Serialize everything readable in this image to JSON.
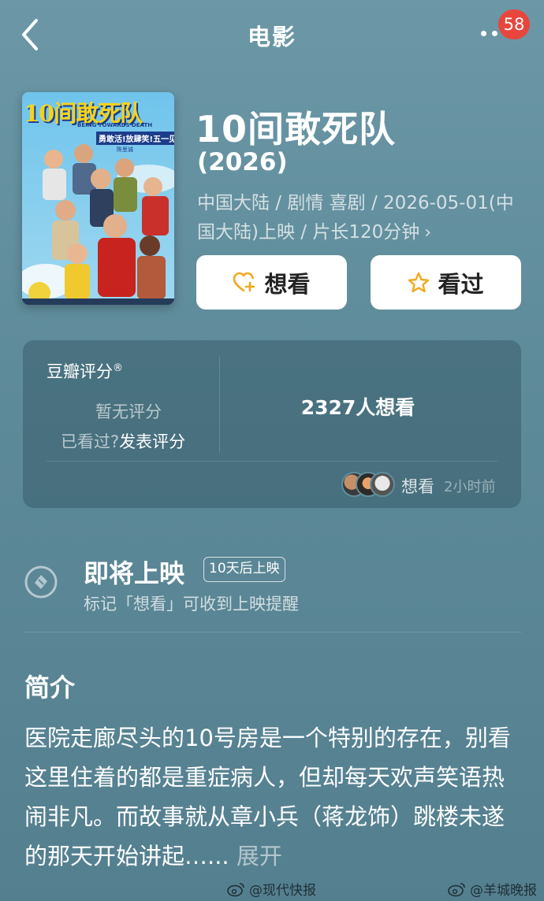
{
  "header": {
    "title": "电影",
    "badge_count": "58"
  },
  "poster": {
    "title_text": "10间敢死队",
    "subtitle_text": "BEING TOWARDS DEATH",
    "tagline_text": "勇敢活!放肆笑!五一见!",
    "credit_text": "陈思诚"
  },
  "movie": {
    "title": "10间敢死队",
    "year": "(2026)",
    "meta": "中国大陆 / 剧情 喜剧 / 2026-05-01(中国大陆)上映 / 片长120分钟",
    "meta_chevron": "›",
    "want_label": "想看",
    "seen_label": "看过"
  },
  "rating": {
    "header": "豆瓣评分",
    "header_mark": "®",
    "no_rating": "暂无评分",
    "seen_question": "已看过?",
    "post_rating": "发表评分",
    "want_count": "2327人想看",
    "activity_label": "想看",
    "activity_time": "2小时前"
  },
  "upcoming": {
    "title": "即将上映",
    "badge": "10天后上映",
    "subtitle": "标记「想看」可收到上映提醒"
  },
  "synopsis": {
    "title": "简介",
    "text": "医院走廊尽头的10号房是一个特别的存在，别看这里住着的都是重症病人，但却每天欢声笑语热闹非凡。而故事就从章小兵（蒋龙饰）跳楼未遂的那天开始讲起…...",
    "expand": "展开"
  },
  "watermarks": {
    "left": "@现代快报",
    "right": "@羊城晚报"
  },
  "colors": {
    "background": "#5d8a99",
    "badge": "#e8463d",
    "button_bg": "#ffffff",
    "star_icon": "#f2a81d",
    "heart_icon": "#f2a81d"
  }
}
